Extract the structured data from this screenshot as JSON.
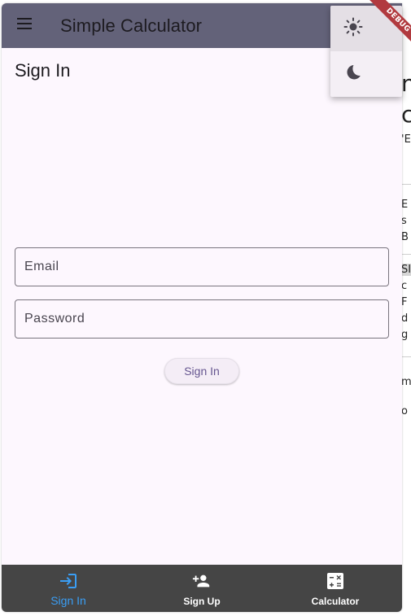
{
  "app": {
    "title": "Simple Calculator",
    "menu_icon": "menu-icon"
  },
  "page": {
    "title": "Sign In"
  },
  "form": {
    "email_placeholder": "Email",
    "email_value": "",
    "password_placeholder": "Password",
    "password_value": "",
    "submit_label": "Sign In"
  },
  "bottom_nav": {
    "items": [
      {
        "label": "Sign In",
        "icon": "login-icon",
        "active": true
      },
      {
        "label": "Sign Up",
        "icon": "person-add-icon",
        "active": false
      },
      {
        "label": "Calculator",
        "icon": "calculate-icon",
        "active": false
      }
    ]
  },
  "theme_menu": {
    "items": [
      {
        "icon": "light-mode-icon",
        "selected": true
      },
      {
        "icon": "dark-mode-icon",
        "selected": false
      }
    ]
  },
  "debug_banner": "DEBUG",
  "colors": {
    "appbar": "#636279",
    "surface": "#fdf7fe",
    "nav_bg": "#454545",
    "nav_active": "#3a9ef5",
    "button_text": "#65558f",
    "debug": "#b13a3f"
  },
  "background_page_fragments": [
    "n",
    "c",
    "'E",
    "E",
    "s",
    "B",
    "SI",
    "c",
    "F",
    "d",
    "g",
    "m",
    "o"
  ]
}
